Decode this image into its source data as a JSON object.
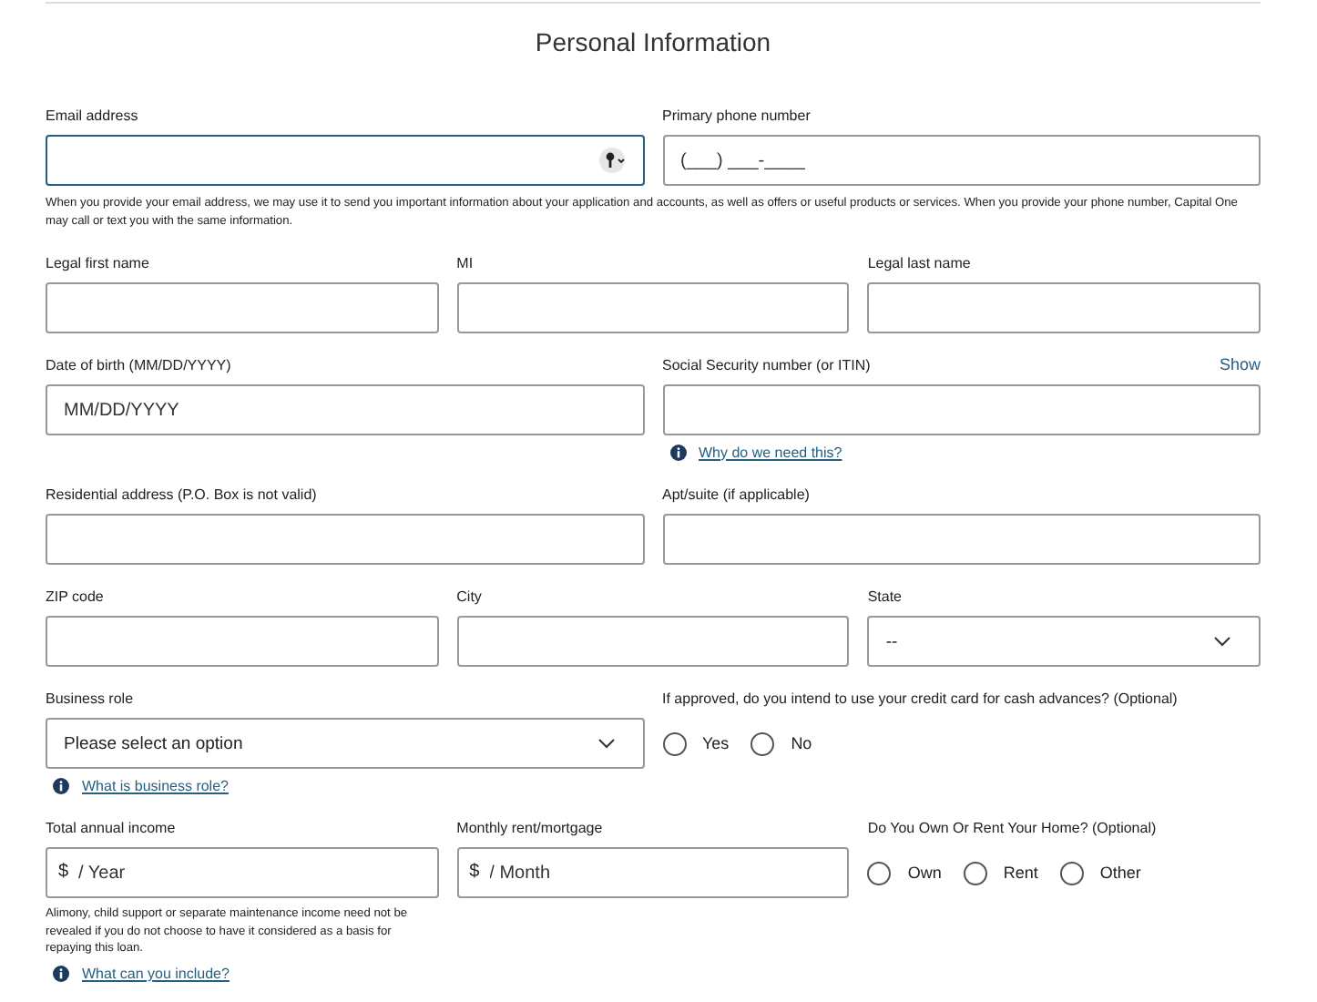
{
  "title": "Personal Information",
  "rows": [
    {
      "fields": [
        {
          "kind": "text",
          "label": "Email address",
          "focused": true,
          "key_icon": true
        },
        {
          "kind": "text",
          "label": "Primary phone number",
          "placeholder": "(___) ___-____"
        }
      ],
      "note": "When you provide your email address, we may use it to send you important information about your application and accounts, as well as offers or useful products or services. When you provide your phone number, Capital One may call or text you with the same information."
    },
    {
      "fields": [
        {
          "kind": "text",
          "label": "Legal first name"
        },
        {
          "kind": "text",
          "label": "MI"
        },
        {
          "kind": "text",
          "label": "Legal last name"
        }
      ]
    },
    {
      "fields": [
        {
          "kind": "text",
          "label": "Date of birth (MM/DD/YYYY)",
          "placeholder": "MM/DD/YYYY"
        },
        {
          "kind": "text",
          "label": "Social Security number (or ITIN)",
          "action": "Show",
          "help": "Why do we need this?"
        }
      ]
    },
    {
      "fields": [
        {
          "kind": "text",
          "label": "Residential address (P.O. Box is not valid)"
        },
        {
          "kind": "text",
          "label": "Apt/suite (if applicable)"
        }
      ]
    },
    {
      "fields": [
        {
          "kind": "text",
          "label": "ZIP code"
        },
        {
          "kind": "text",
          "label": "City"
        },
        {
          "kind": "select",
          "label": "State",
          "placeholder": "--"
        }
      ]
    },
    {
      "fields": [
        {
          "kind": "select",
          "label": "Business role",
          "placeholder": "Please select an option",
          "help": "What is business role?"
        },
        {
          "kind": "radio",
          "label": "If approved, do you intend to use your credit card for cash advances? (Optional)",
          "options": [
            {
              "label": "Yes",
              "selected": false
            },
            {
              "label": "No",
              "selected": false
            }
          ]
        }
      ]
    },
    {
      "fields": [
        {
          "kind": "text",
          "label": "Total annual income",
          "prefix": "$",
          "placeholder": "/ Year",
          "note": "Alimony, child support or separate maintenance income need not be revealed if you do not choose to have it considered as a basis for repaying this loan.",
          "help": "What can you include?"
        },
        {
          "kind": "text",
          "label": "Monthly rent/mortgage",
          "prefix": "$",
          "placeholder": "/ Month"
        },
        {
          "kind": "radio",
          "label": "Do You Own Or Rent Your Home? (Optional)",
          "options": [
            {
              "label": "Own",
              "selected": false
            },
            {
              "label": "Rent",
              "selected": false
            },
            {
              "label": "Other",
              "selected": false
            }
          ]
        }
      ]
    }
  ]
}
